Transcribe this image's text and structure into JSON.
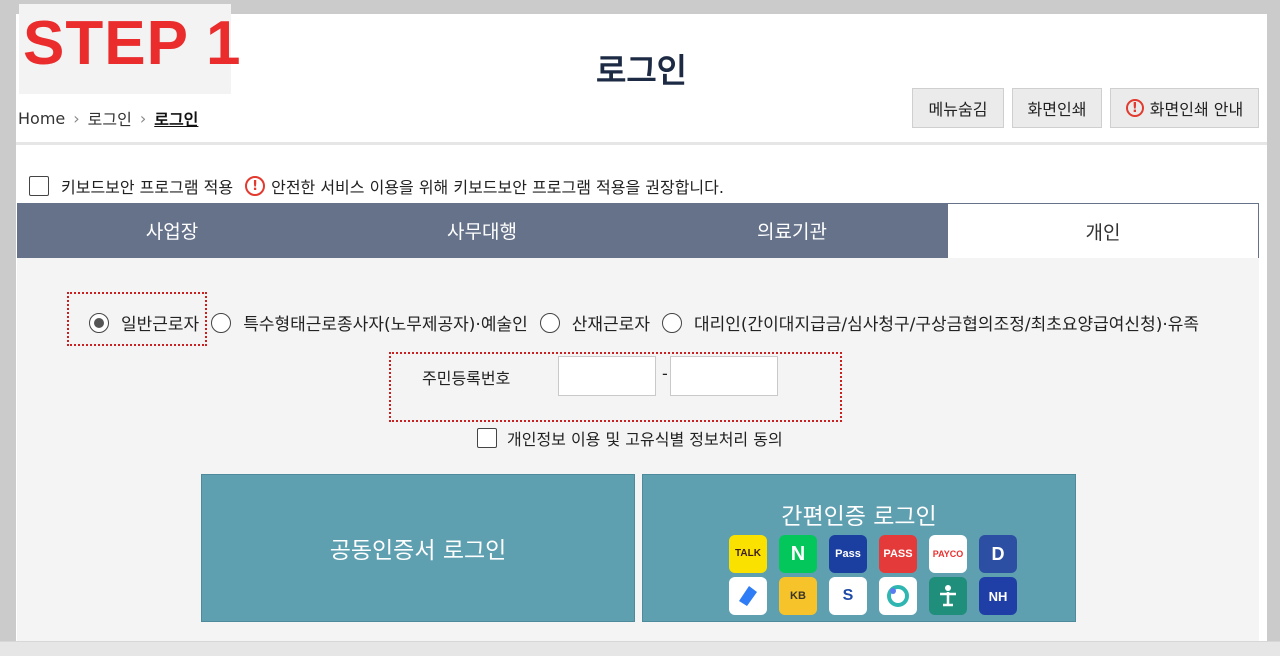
{
  "step_label": "STEP 1",
  "page_title": "로그인",
  "breadcrumb": {
    "home": "Home",
    "item1": "로그인",
    "current": "로그인"
  },
  "top_buttons": {
    "hide_menu": "메뉴숨김",
    "print": "화면인쇄",
    "print_guide": "화면인쇄 안내"
  },
  "keyboard_security": {
    "label": "키보드보안 프로그램 적용",
    "notice": "안전한 서비스 이용을 위해 키보드보안 프로그램 적용을 권장합니다."
  },
  "tabs": [
    {
      "label": "사업장",
      "active": false
    },
    {
      "label": "사무대행",
      "active": false
    },
    {
      "label": "의료기관",
      "active": false
    },
    {
      "label": "개인",
      "active": true
    }
  ],
  "user_types": [
    {
      "label": "일반근로자",
      "selected": true
    },
    {
      "label": "특수형태근로종사자(노무제공자)·예술인",
      "selected": false
    },
    {
      "label": "산재근로자",
      "selected": false
    },
    {
      "label": "대리인(간이대지급금/심사청구/구상금협의조정/최초요양급여신청)·유족",
      "selected": false
    }
  ],
  "rrn": {
    "label": "주민등록번호",
    "separator": "-",
    "first": "",
    "second": ""
  },
  "privacy_agree": "개인정보 이용 및 고유식별 정보처리 동의",
  "cert_login": "공동인증서 로그인",
  "simple_login": {
    "label": "간편인증 로그인",
    "providers": [
      {
        "name": "kakaotalk-icon",
        "text": "TALK",
        "bg": "#fae100",
        "fg": "#3c1e1e"
      },
      {
        "name": "naver-icon",
        "text": "N",
        "bg": "#03c75a",
        "fg": "#ffffff"
      },
      {
        "name": "samsung-pass-icon",
        "text": "Pass",
        "bg": "#1b3fa0",
        "fg": "#ffffff"
      },
      {
        "name": "pass-icon",
        "text": "PASS",
        "bg": "#e53a3a",
        "fg": "#ffffff"
      },
      {
        "name": "payco-icon",
        "text": "PAYCO",
        "bg": "#ffffff",
        "fg": "#e8312f"
      },
      {
        "name": "dream-shield-icon",
        "text": "D",
        "bg": "#2d4fa3",
        "fg": "#ffffff"
      },
      {
        "name": "toss-icon",
        "text": "",
        "bg": "#ffffff",
        "fg": "#2f7df6"
      },
      {
        "name": "kb-bank-icon",
        "text": "KB",
        "bg": "#f6c42a",
        "fg": "#3b3427"
      },
      {
        "name": "shinhan-bank-icon",
        "text": "S",
        "bg": "#ffffff",
        "fg": "#1f4aa8"
      },
      {
        "name": "banksalad-icon",
        "text": "",
        "bg": "#ffffff",
        "fg": "#2fb6b0"
      },
      {
        "name": "hana-bank-icon",
        "text": "",
        "bg": "#1f8f7c",
        "fg": "#ffffff"
      },
      {
        "name": "nh-bank-icon",
        "text": "NH",
        "bg": "#1f3fa6",
        "fg": "#ffffff"
      }
    ]
  }
}
